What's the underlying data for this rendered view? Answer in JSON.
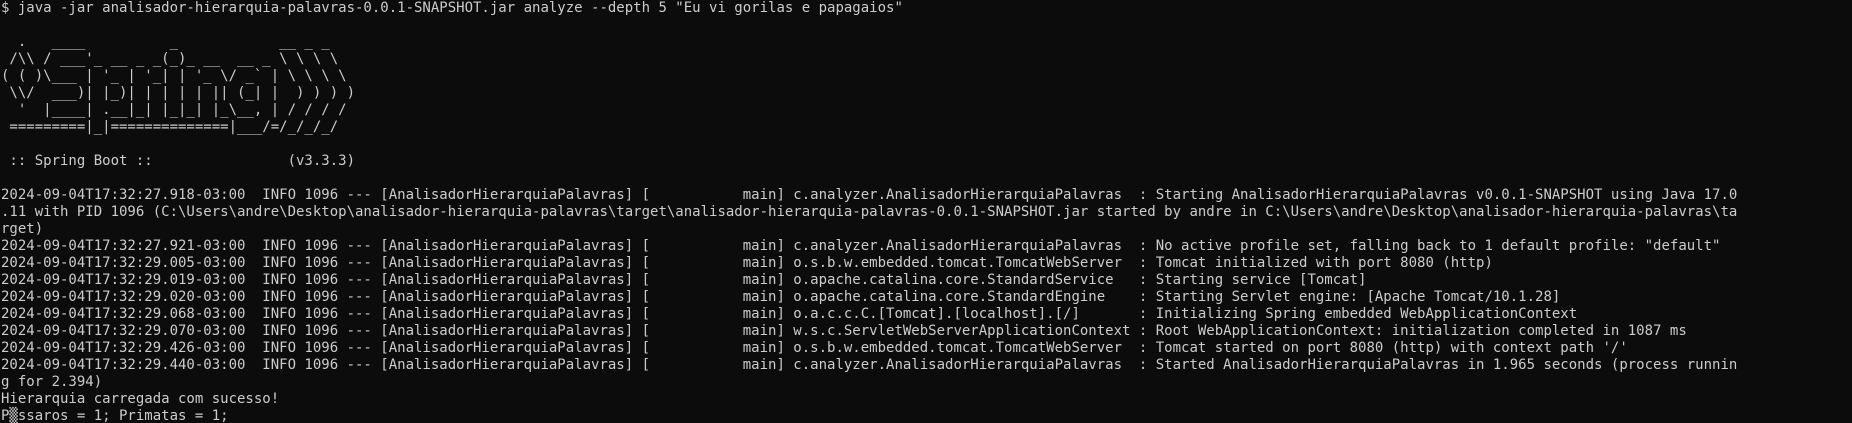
{
  "terminal": {
    "lines": [
      "$ java -jar analisador-hierarquia-palavras-0.0.1-SNAPSHOT.jar analyze --depth 5 \"Eu vi gorilas e papagaios\"",
      "",
      "  .   ____          _            __ _ _",
      " /\\\\ / ___'_ __ _ _(_)_ __  __ _ \\ \\ \\ \\",
      "( ( )\\___ | '_ | '_| | '_ \\/ _` | \\ \\ \\ \\",
      " \\\\/  ___)| |_)| | | | | || (_| |  ) ) ) )",
      "  '  |____| .__|_| |_|_| |_\\__, | / / / /",
      " =========|_|==============|___/=/_/_/_/",
      "",
      " :: Spring Boot ::                (v3.3.3)",
      "",
      "2024-09-04T17:32:27.918-03:00  INFO 1096 --- [AnalisadorHierarquiaPalavras] [           main] c.analyzer.AnalisadorHierarquiaPalavras  : Starting AnalisadorHierarquiaPalavras v0.0.1-SNAPSHOT using Java 17.0",
      ".11 with PID 1096 (C:\\Users\\andre\\Desktop\\analisador-hierarquia-palavras\\target\\analisador-hierarquia-palavras-0.0.1-SNAPSHOT.jar started by andre in C:\\Users\\andre\\Desktop\\analisador-hierarquia-palavras\\ta",
      "rget)",
      "2024-09-04T17:32:27.921-03:00  INFO 1096 --- [AnalisadorHierarquiaPalavras] [           main] c.analyzer.AnalisadorHierarquiaPalavras  : No active profile set, falling back to 1 default profile: \"default\"",
      "2024-09-04T17:32:29.005-03:00  INFO 1096 --- [AnalisadorHierarquiaPalavras] [           main] o.s.b.w.embedded.tomcat.TomcatWebServer  : Tomcat initialized with port 8080 (http)",
      "2024-09-04T17:32:29.019-03:00  INFO 1096 --- [AnalisadorHierarquiaPalavras] [           main] o.apache.catalina.core.StandardService   : Starting service [Tomcat]",
      "2024-09-04T17:32:29.020-03:00  INFO 1096 --- [AnalisadorHierarquiaPalavras] [           main] o.apache.catalina.core.StandardEngine    : Starting Servlet engine: [Apache Tomcat/10.1.28]",
      "2024-09-04T17:32:29.068-03:00  INFO 1096 --- [AnalisadorHierarquiaPalavras] [           main] o.a.c.c.C.[Tomcat].[localhost].[/]       : Initializing Spring embedded WebApplicationContext",
      "2024-09-04T17:32:29.070-03:00  INFO 1096 --- [AnalisadorHierarquiaPalavras] [           main] w.s.c.ServletWebServerApplicationContext : Root WebApplicationContext: initialization completed in 1087 ms",
      "2024-09-04T17:32:29.426-03:00  INFO 1096 --- [AnalisadorHierarquiaPalavras] [           main] o.s.b.w.embedded.tomcat.TomcatWebServer  : Tomcat started on port 8080 (http) with context path '/'",
      "2024-09-04T17:32:29.440-03:00  INFO 1096 --- [AnalisadorHierarquiaPalavras] [           main] c.analyzer.AnalisadorHierarquiaPalavras  : Started AnalisadorHierarquiaPalavras in 1.965 seconds (process runnin",
      "g for 2.394)",
      "Hierarquia carregada com sucesso!",
      "P▒ssaros = 1; Primatas = 1;"
    ]
  }
}
